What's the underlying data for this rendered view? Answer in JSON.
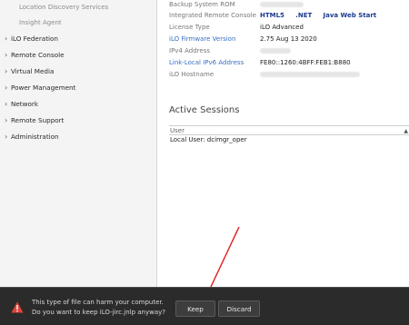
{
  "sidebar": {
    "subitems": [
      "Location Discovery Services",
      "Insight Agent"
    ],
    "items": [
      {
        "label": "iLO Federation"
      },
      {
        "label": "Remote Console"
      },
      {
        "label": "Virtual Media"
      },
      {
        "label": "Power Management"
      },
      {
        "label": "Network"
      },
      {
        "label": "Remote Support"
      },
      {
        "label": "Administration"
      }
    ]
  },
  "info": {
    "backup_rom_label": "Backup System ROM",
    "remote_console_label": "Integrated Remote Console",
    "remote_console_links": [
      "HTML5",
      ".NET",
      "Java Web Start"
    ],
    "license_type_label": "License Type",
    "license_type_value": "iLO Advanced",
    "firmware_label": "iLO Firmware Version",
    "firmware_value": "2.75 Aug 13 2020",
    "ipv4_label": "IPv4 Address",
    "ipv6_label": "Link-Local IPv6 Address",
    "ipv6_value": "FE80::1260:4BFF:FEB1:B880",
    "hostname_label": "iLO Hostname"
  },
  "sessions": {
    "title": "Active Sessions",
    "column_header": "User",
    "rows": [
      "Local User: dcimgr_oper"
    ]
  },
  "download_bar": {
    "message_line1": "This type of file can harm your computer.",
    "message_line2": "Do you want to keep iLO-jirc.jnlp anyway?",
    "keep_label": "Keep",
    "discard_label": "Discard"
  },
  "colors": {
    "link_blue": "#3a6fc4",
    "rc_link": "#1a3b8f",
    "annotation_arrow": "#e01b1b",
    "warning_icon": "#e0453a"
  }
}
